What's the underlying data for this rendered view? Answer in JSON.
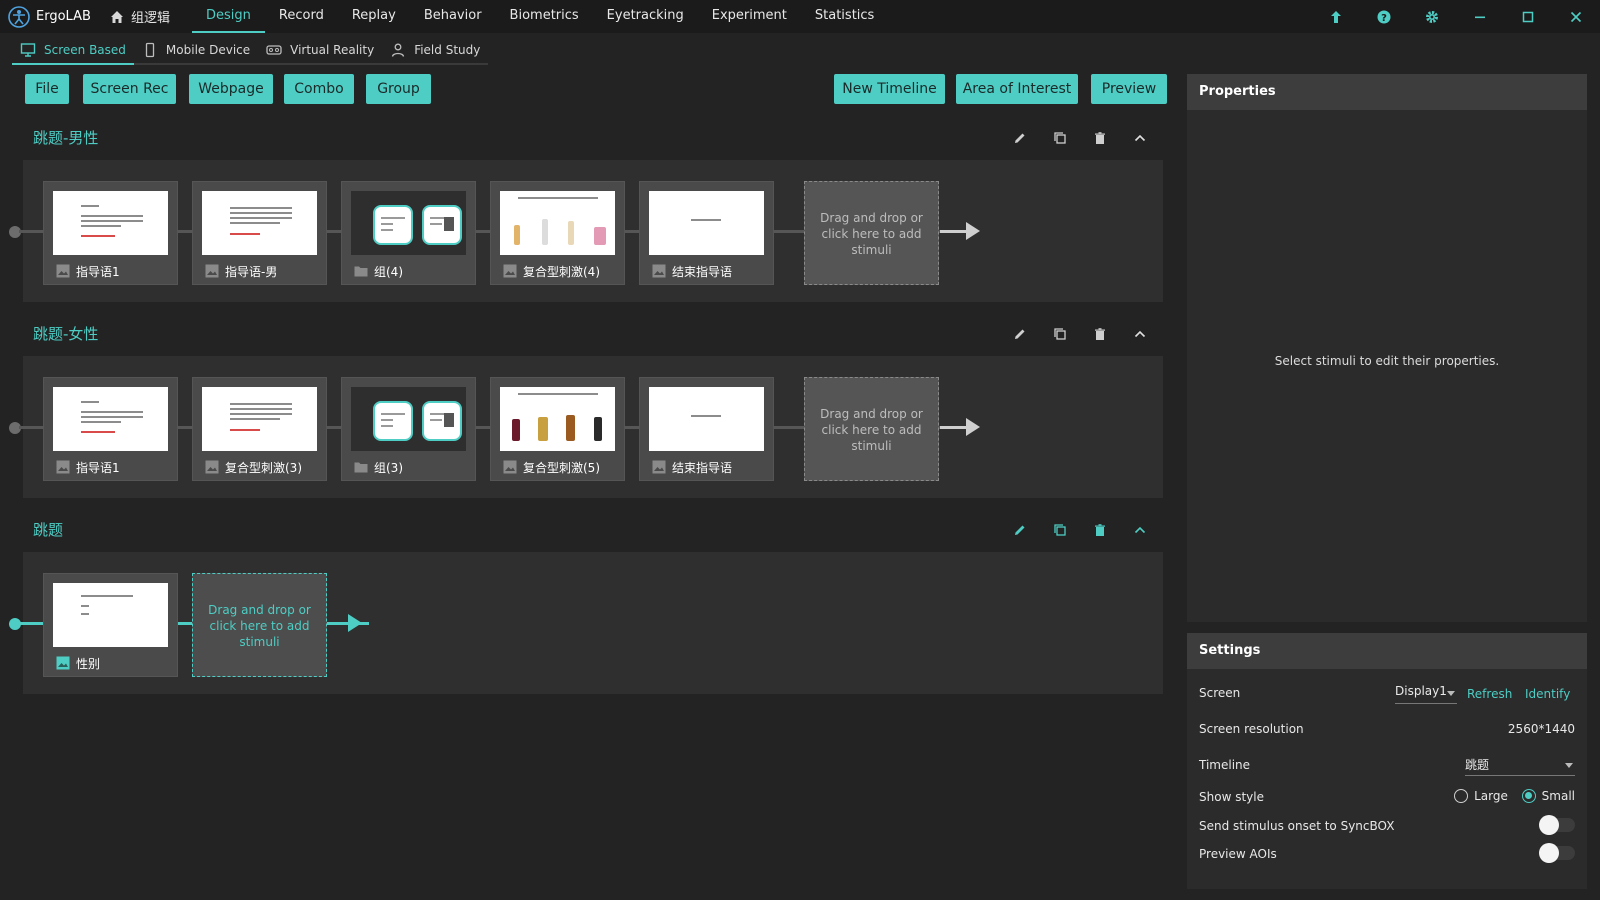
{
  "app": {
    "name": "ErgoLAB",
    "module": "组逻辑"
  },
  "menu": [
    "Design",
    "Record",
    "Replay",
    "Behavior",
    "Biometrics",
    "Eyetracking",
    "Experiment",
    "Statistics"
  ],
  "subtabs": [
    "Screen Based",
    "Mobile Device",
    "Virtual Reality",
    "Field Study"
  ],
  "toolbar_left": [
    "File",
    "Screen Rec",
    "Webpage",
    "Combo",
    "Group"
  ],
  "toolbar_right": [
    "New Timeline",
    "Area of Interest",
    "Preview"
  ],
  "timelines": [
    {
      "title": "跳题-男性",
      "cards": [
        "指导语1",
        "指导语-男",
        "组(4)",
        "复合型刺激(4)",
        "结束指导语"
      ],
      "drop": "Drag and drop or click here to add stimuli"
    },
    {
      "title": "跳题-女性",
      "cards": [
        "指导语1",
        "复合型刺激(3)",
        "组(3)",
        "复合型刺激(5)",
        "结束指导语"
      ],
      "drop": "Drag and drop or click here to add stimuli"
    },
    {
      "title": "跳题",
      "cards": [
        "性别"
      ],
      "drop": "Drag and drop or click here to add stimuli"
    }
  ],
  "properties": {
    "title": "Properties",
    "hint": "Select stimuli to edit their properties."
  },
  "settings": {
    "title": "Settings",
    "screen_label": "Screen",
    "screen_value": "Display1",
    "refresh": "Refresh",
    "identify": "Identify",
    "resolution_label": "Screen resolution",
    "resolution_value": "2560*1440",
    "timeline_label": "Timeline",
    "timeline_value": "跳题",
    "show_style_label": "Show style",
    "style_large": "Large",
    "style_small": "Small",
    "syncbox_label": "Send stimulus onset to SyncBOX",
    "preview_aois_label": "Preview AOIs"
  },
  "colors": {
    "accent": "#4ecdc4",
    "background": "#232323",
    "panel": "#2f2f2f"
  }
}
